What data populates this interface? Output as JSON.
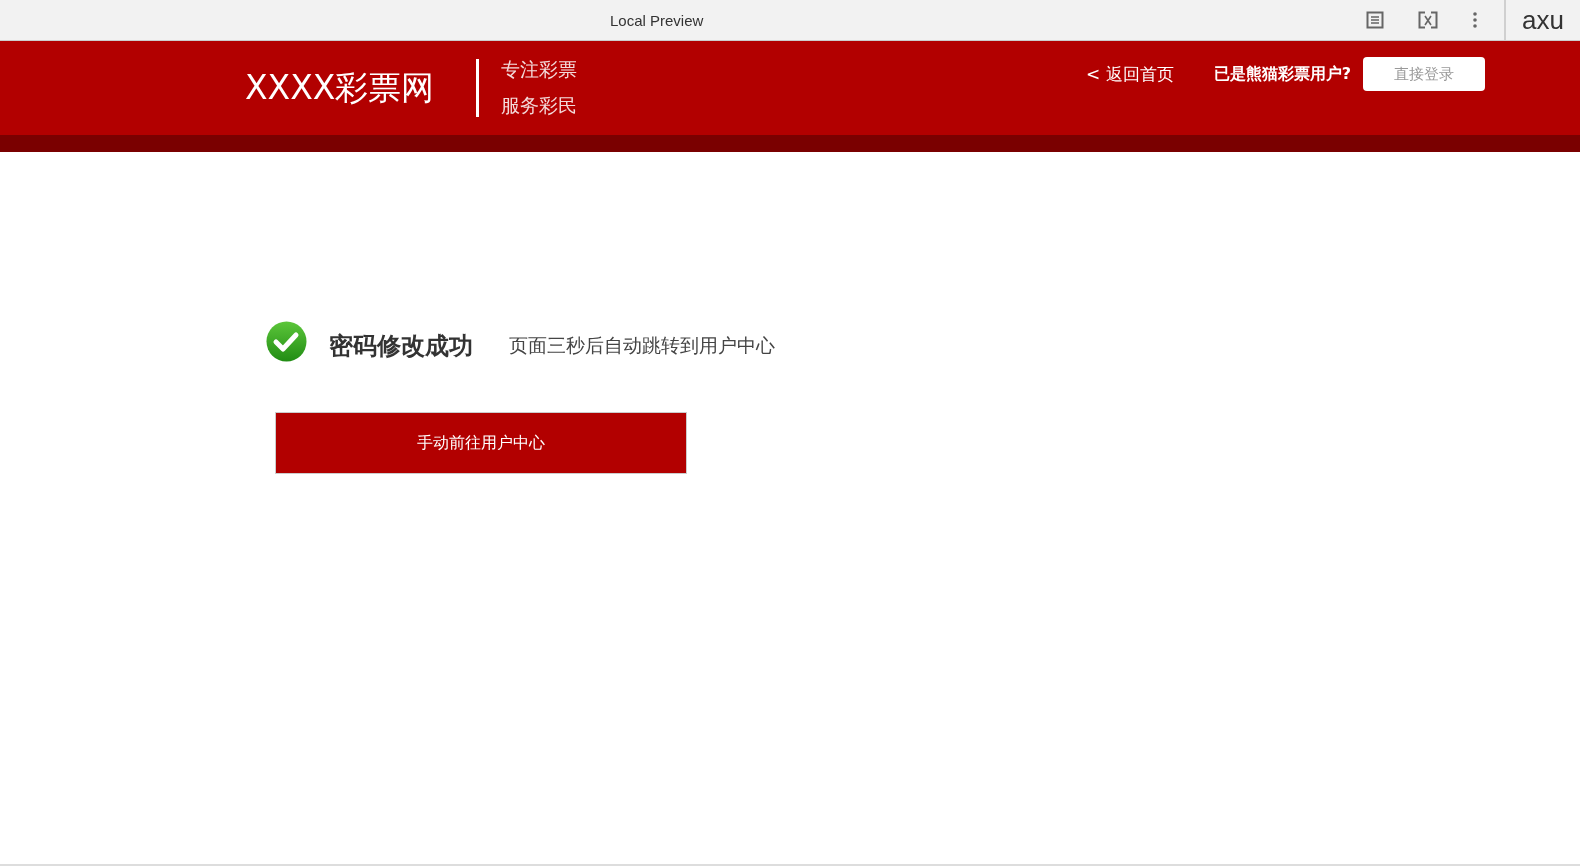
{
  "preview_bar": {
    "title": "Local Preview",
    "logo": "axu"
  },
  "header": {
    "logo": "XXXX彩票网",
    "slogan": [
      "专注彩票",
      "服务彩民"
    ],
    "back_link": "< 返回首页",
    "prompt": "已是熊猫彩票用户?",
    "login_button": "直接登录"
  },
  "message": {
    "title": "密码修改成功",
    "subtitle": "页面三秒后自动跳转到用户中心"
  },
  "button": "手动前往用户中心"
}
